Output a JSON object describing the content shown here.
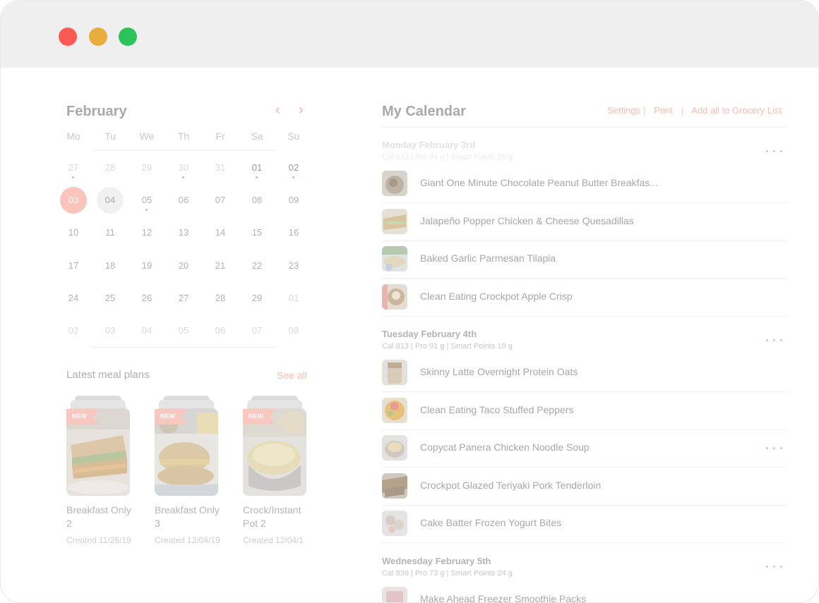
{
  "calendar": {
    "month": "February",
    "weekdays": [
      "Mo",
      "Tu",
      "We",
      "Th",
      "Fr",
      "Sa",
      "Su"
    ],
    "weeks": [
      [
        "27",
        "28",
        "29",
        "30",
        "31",
        "01",
        "02"
      ],
      [
        "03",
        "04",
        "05",
        "06",
        "07",
        "08",
        "09"
      ],
      [
        "10",
        "11",
        "12",
        "13",
        "14",
        "15",
        "16"
      ],
      [
        "17",
        "18",
        "19",
        "20",
        "21",
        "22",
        "23"
      ],
      [
        "24",
        "25",
        "26",
        "27",
        "28",
        "29",
        "01"
      ],
      [
        "02",
        "03",
        "04",
        "05",
        "06",
        "07",
        "08"
      ]
    ]
  },
  "latest": {
    "title": "Latest meal plans",
    "see_all": "See all",
    "badge": "NEW",
    "plans": [
      {
        "name": "Breakfast Only 2",
        "created": "Created 11/26/19"
      },
      {
        "name": "Breakfast Only 3",
        "created": "Created 12/04/19"
      },
      {
        "name": "Crock/Instant Pot 2",
        "created": "Created 12/04/1"
      }
    ]
  },
  "my_calendar": {
    "title": "My Calendar",
    "actions": [
      "Settings",
      "Print",
      "Add all to Grocery List"
    ],
    "days": [
      {
        "name": "Monday February 3rd",
        "stats": "Cal 823 | Pro 84 g | Smart Points 25 g",
        "meals": [
          "Giant One Minute Chocolate Peanut Butter Breakfas...",
          "Jalapeño Popper Chicken & Cheese Quesadillas",
          "Baked Garlic Parmesan Tilapia",
          "Clean Eating Crockpot Apple Crisp"
        ]
      },
      {
        "name": "Tuesday February 4th",
        "stats": "Cal 813 | Pro 91 g | Smart Points 19 g",
        "meals": [
          "Skinny Latte Overnight Protein Oats",
          "Clean Eating Taco Stuffed Peppers",
          "Copycat Panera Chicken Noodle Soup",
          "Crockpot Glazed Teriyaki Pork Tenderloin",
          "Cake Batter Frozen Yogurt Bites"
        ]
      },
      {
        "name": "Wednesday February 5th",
        "stats": "Cal 836 | Pro 73 g | Smart Points 24 g",
        "meals": [
          "Make Ahead Freezer Smoothie Packs"
        ]
      }
    ]
  },
  "colors": {
    "accent": "#f7bdb3",
    "today": "#f8c4bb",
    "window_red": "#fc5a52",
    "window_yellow": "#e8ad3c",
    "window_green": "#2ec25c"
  }
}
